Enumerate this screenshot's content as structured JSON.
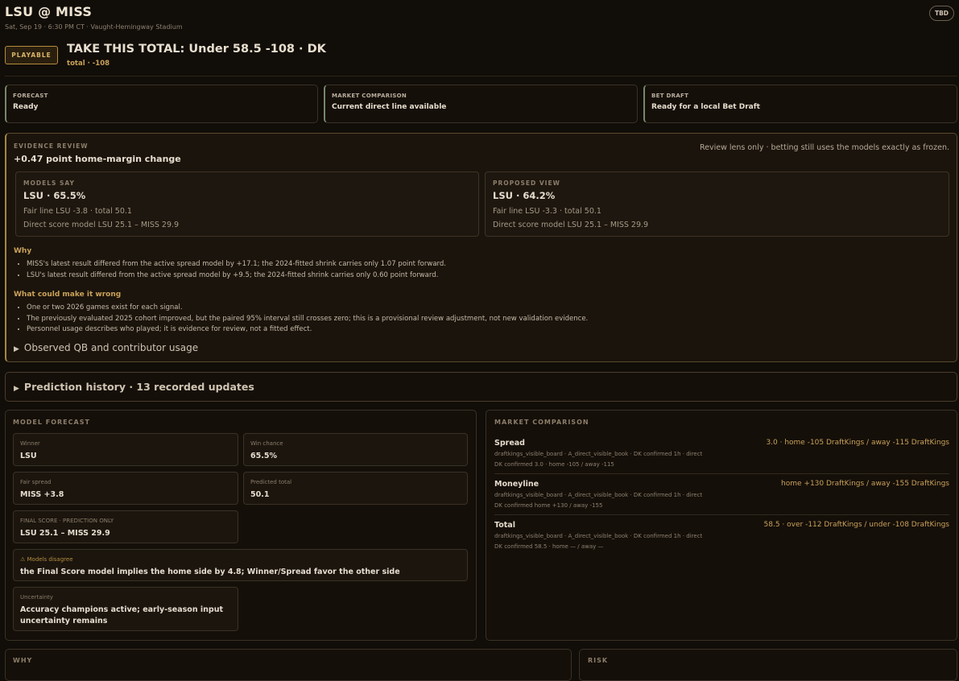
{
  "header": {
    "title": "LSU @ MISS",
    "subtitle": "Sat, Sep 19 · 6:30 PM CT · Vaught-Hemingway Stadium",
    "badge": "TBD"
  },
  "pick": {
    "status": "PLAYABLE",
    "headline": "TAKE THIS TOTAL: Under 58.5 -108 · DK",
    "detail": "total · -108"
  },
  "status_cards": [
    {
      "label": "FORECAST",
      "value": "Ready"
    },
    {
      "label": "MARKET COMPARISON",
      "value": "Current direct line available"
    },
    {
      "label": "BET DRAFT",
      "value": "Ready for a local Bet Draft"
    }
  ],
  "evidence": {
    "label": "EVIDENCE REVIEW",
    "title": "+0.47 point home-margin change",
    "note": "Review lens only · betting still uses the models exactly as frozen.",
    "models_say": {
      "label": "MODELS SAY",
      "pick": "LSU · 65.5%",
      "fair_line": "Fair line LSU -3.8 · total 50.1",
      "direct": "Direct score model LSU 25.1 – MISS 29.9"
    },
    "proposed": {
      "label": "PROPOSED VIEW",
      "pick": "LSU · 64.2%",
      "fair_line": "Fair line LSU -3.3 · total 50.1",
      "direct": "Direct score model LSU 25.1 – MISS 29.9"
    },
    "why_label": "Why",
    "why": [
      "MISS's latest result differed from the active spread model by +17.1; the 2024-fitted shrink carries only 1.07 point forward.",
      "LSU's latest result differed from the active spread model by +9.5; the 2024-fitted shrink carries only 0.60 point forward."
    ],
    "wrong_label": "What could make it wrong",
    "wrong": [
      "One or two 2026 games exist for each signal.",
      "The previously evaluated 2025 cohort improved, but the paired 95% interval still crosses zero; this is a provisional review adjustment, not new validation evidence.",
      "Personnel usage describes who played; it is evidence for review, not a fitted effect."
    ],
    "qb_toggle": "Observed QB and contributor usage"
  },
  "history": {
    "label": "Prediction history · 13 recorded updates"
  },
  "model_forecast": {
    "label": "MODEL FORECAST",
    "winner": {
      "label": "Winner",
      "value": "LSU"
    },
    "win_chance": {
      "label": "Win chance",
      "value": "65.5%"
    },
    "fair_spread": {
      "label": "Fair spread",
      "value": "MISS +3.8"
    },
    "predicted_total": {
      "label": "Predicted total",
      "value": "50.1"
    },
    "final_score": {
      "label": "FINAL SCORE · PREDICTION ONLY",
      "value": "LSU 25.1 – MISS 29.9"
    },
    "disagree": {
      "label": "⚠ Models disagree",
      "value": "the Final Score model implies the home side by 4.8; Winner/Spread favor the other side"
    },
    "uncertainty": {
      "label": "Uncertainty",
      "value_1": "Accuracy champions active; early-season input",
      "value_2": "uncertainty remains"
    }
  },
  "market": {
    "label": "MARKET COMPARISON",
    "rows": [
      {
        "name": "Spread",
        "value": "3.0 · home -105 DraftKings / away -115 DraftKings",
        "source": "draftkings_visible_board · A_direct_visible_book · DK confirmed 1h · direct",
        "confirmed": "DK confirmed 3.0 · home -105 / away -115"
      },
      {
        "name": "Moneyline",
        "value": "home +130 DraftKings / away -155 DraftKings",
        "source": "draftkings_visible_board · A_direct_visible_book · DK confirmed 1h · direct",
        "confirmed": "DK confirmed home +130 / away -155"
      },
      {
        "name": "Total",
        "value": "58.5 · over -112 DraftKings / under -108 DraftKings",
        "source": "draftkings_visible_board · A_direct_visible_book · DK confirmed 1h · direct",
        "confirmed": "DK confirmed 58.5 · home — / away —"
      }
    ]
  },
  "bottom": {
    "why": "WHY",
    "risk": "RISK"
  },
  "colors": {
    "accent": "#c9a25a",
    "background": "#110d08",
    "status_border": "#75886a"
  }
}
